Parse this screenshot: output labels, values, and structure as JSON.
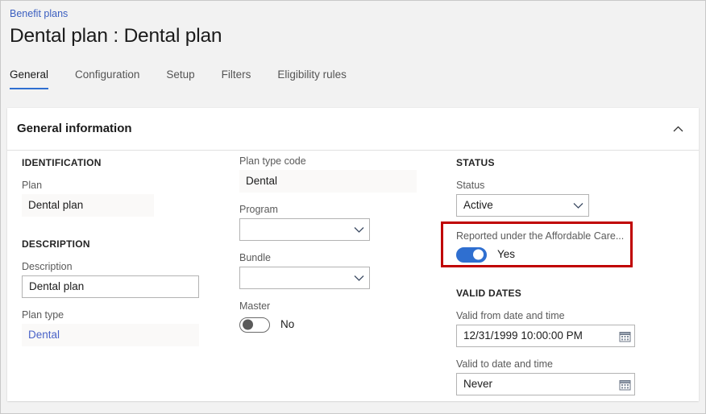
{
  "breadcrumb": {
    "label": "Benefit plans"
  },
  "header": {
    "title": "Dental plan : Dental plan"
  },
  "tabs": [
    {
      "label": "General"
    },
    {
      "label": "Configuration"
    },
    {
      "label": "Setup"
    },
    {
      "label": "Filters"
    },
    {
      "label": "Eligibility rules"
    }
  ],
  "section": {
    "title": "General information",
    "collapse_icon": "chevron-up-icon"
  },
  "identification": {
    "group_label": "IDENTIFICATION",
    "plan": {
      "label": "Plan",
      "value": "Dental plan"
    }
  },
  "description_group": {
    "group_label": "DESCRIPTION",
    "description": {
      "label": "Description",
      "value": "Dental plan",
      "placeholder": ""
    },
    "plan_type": {
      "label": "Plan type",
      "value": "Dental"
    }
  },
  "middle": {
    "plan_type_code": {
      "label": "Plan type code",
      "value": "Dental"
    },
    "program": {
      "label": "Program",
      "value": "",
      "icon": "chevron-down-icon"
    },
    "bundle": {
      "label": "Bundle",
      "value": "",
      "icon": "chevron-down-icon"
    },
    "master": {
      "label": "Master",
      "state": "No",
      "on": false
    }
  },
  "status_group": {
    "group_label": "STATUS",
    "status": {
      "label": "Status",
      "value": "Active",
      "icon": "chevron-down-icon"
    },
    "aca": {
      "label": "Reported under the Affordable Care...",
      "state": "Yes",
      "on": true
    }
  },
  "valid_dates": {
    "group_label": "VALID DATES",
    "valid_from": {
      "label": "Valid from date and time",
      "value": "12/31/1999 10:00:00 PM",
      "icon": "calendar-icon"
    },
    "valid_to": {
      "label": "Valid to date and time",
      "value": "Never",
      "icon": "calendar-icon"
    }
  },
  "colors": {
    "accent": "#2f6fd0",
    "link": "#3b5fc0",
    "annotation": "#c00000",
    "page_background": "#f2f2f2",
    "card_background": "#ffffff"
  }
}
